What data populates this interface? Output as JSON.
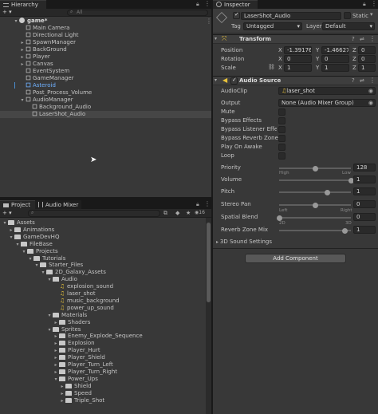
{
  "hierarchy": {
    "tab_label": "Hierarchy",
    "add_label": "+ ▾",
    "search_placeholder": "All",
    "scene_name": "game*",
    "items": [
      {
        "label": "Main Camera",
        "depth": 1,
        "arrow": ""
      },
      {
        "label": "Directional Light",
        "depth": 1,
        "arrow": ""
      },
      {
        "label": "SpawnManager",
        "depth": 1,
        "arrow": "▸"
      },
      {
        "label": "BackGround",
        "depth": 1,
        "arrow": "▸"
      },
      {
        "label": "Player",
        "depth": 1,
        "arrow": "▸"
      },
      {
        "label": "Canvas",
        "depth": 1,
        "arrow": "▸"
      },
      {
        "label": "EventSystem",
        "depth": 1,
        "arrow": ""
      },
      {
        "label": "GameManager",
        "depth": 1,
        "arrow": ""
      },
      {
        "label": "Asteroid",
        "depth": 1,
        "arrow": "",
        "color": "#6fb1ff"
      },
      {
        "label": "Post_Process_Volume",
        "depth": 1,
        "arrow": ""
      },
      {
        "label": "AudioManager",
        "depth": 1,
        "arrow": "▾"
      },
      {
        "label": "Background_Audio",
        "depth": 2,
        "arrow": ""
      },
      {
        "label": "LaserShot_Audio",
        "depth": 2,
        "arrow": "",
        "selected": true
      }
    ]
  },
  "project": {
    "tab_project": "Project",
    "tab_mixer": "Audio Mixer",
    "add_label": "+ ▾",
    "hidden_count": "16",
    "items": [
      {
        "label": "Assets",
        "depth": 0,
        "arrow": "▾",
        "icon": "folder"
      },
      {
        "label": "Animations",
        "depth": 1,
        "arrow": "▸",
        "icon": "folder"
      },
      {
        "label": "GameDevHQ",
        "depth": 1,
        "arrow": "▾",
        "icon": "folder"
      },
      {
        "label": "FileBase",
        "depth": 2,
        "arrow": "▾",
        "icon": "folder"
      },
      {
        "label": "Projects",
        "depth": 3,
        "arrow": "▾",
        "icon": "folder"
      },
      {
        "label": "Tutorials",
        "depth": 4,
        "arrow": "▾",
        "icon": "folder"
      },
      {
        "label": "Starter_Files",
        "depth": 5,
        "arrow": "▾",
        "icon": "folder"
      },
      {
        "label": "2D_Galaxy_Assets",
        "depth": 6,
        "arrow": "▾",
        "icon": "folder"
      },
      {
        "label": "Audio",
        "depth": 7,
        "arrow": "▾",
        "icon": "folder"
      },
      {
        "label": "explosion_sound",
        "depth": 8,
        "arrow": "",
        "icon": "audio"
      },
      {
        "label": "laser_shot",
        "depth": 8,
        "arrow": "",
        "icon": "audio"
      },
      {
        "label": "music_background",
        "depth": 8,
        "arrow": "",
        "icon": "audio"
      },
      {
        "label": "power_up_sound",
        "depth": 8,
        "arrow": "",
        "icon": "audio"
      },
      {
        "label": "Materials",
        "depth": 7,
        "arrow": "▾",
        "icon": "folder"
      },
      {
        "label": "Shaders",
        "depth": 8,
        "arrow": "▸",
        "icon": "folder"
      },
      {
        "label": "Sprites",
        "depth": 7,
        "arrow": "▾",
        "icon": "folder"
      },
      {
        "label": "Enemy_Explode_Sequence",
        "depth": 8,
        "arrow": "▸",
        "icon": "folder"
      },
      {
        "label": "Explosion",
        "depth": 8,
        "arrow": "▸",
        "icon": "folder"
      },
      {
        "label": "Player_Hurt",
        "depth": 8,
        "arrow": "▸",
        "icon": "folder"
      },
      {
        "label": "Player_Shield",
        "depth": 8,
        "arrow": "▸",
        "icon": "folder"
      },
      {
        "label": "Player_Turn_Left",
        "depth": 8,
        "arrow": "▸",
        "icon": "folder"
      },
      {
        "label": "Player_Turn_Right",
        "depth": 8,
        "arrow": "▸",
        "icon": "folder"
      },
      {
        "label": "Power_Ups",
        "depth": 8,
        "arrow": "▾",
        "icon": "folder"
      },
      {
        "label": "Shield",
        "depth": 9,
        "arrow": "▸",
        "icon": "folder"
      },
      {
        "label": "Speed",
        "depth": 9,
        "arrow": "▸",
        "icon": "folder"
      },
      {
        "label": "Triple_Shot",
        "depth": 9,
        "arrow": "▸",
        "icon": "folder"
      }
    ]
  },
  "inspector": {
    "tab_label": "Inspector",
    "object_name": "LaserShot_Audio",
    "static_label": "Static",
    "tag_label": "Tag",
    "tag_value": "Untagged",
    "layer_label": "Layer",
    "layer_value": "Default",
    "transform": {
      "title": "Transform",
      "position_label": "Position",
      "rotation_label": "Rotation",
      "scale_label": "Scale",
      "position": {
        "x": "-1.39176",
        "y": "-1.46627",
        "z": "0"
      },
      "rotation": {
        "x": "0",
        "y": "0",
        "z": "0"
      },
      "scale": {
        "x": "1",
        "y": "1",
        "z": "1"
      }
    },
    "audio_source": {
      "title": "Audio Source",
      "audioclip_label": "AudioClip",
      "audioclip_value": "laser_shot",
      "output_label": "Output",
      "output_value": "None (Audio Mixer Group)",
      "mute_label": "Mute",
      "bypass_effects_label": "Bypass Effects",
      "bypass_listener_label": "Bypass Listener Effects",
      "bypass_reverb_label": "Bypass Reverb Zones",
      "play_on_awake_label": "Play On Awake",
      "loop_label": "Loop",
      "priority_label": "Priority",
      "priority_value": "128",
      "priority_fraction": 0.5,
      "priority_high": "High",
      "priority_low": "Low",
      "volume_label": "Volume",
      "volume_value": "1",
      "volume_fraction": 1.0,
      "pitch_label": "Pitch",
      "pitch_value": "1",
      "pitch_fraction": 0.67,
      "stereo_label": "Stereo Pan",
      "stereo_value": "0",
      "stereo_fraction": 0.5,
      "stereo_left": "Left",
      "stereo_right": "Right",
      "spatial_label": "Spatial Blend",
      "spatial_value": "0",
      "spatial_fraction": 0.0,
      "spatial_2d": "2D",
      "spatial_3d": "3D",
      "reverb_label": "Reverb Zone Mix",
      "reverb_value": "1",
      "reverb_fraction": 0.91,
      "sound3d_label": "3D Sound Settings"
    },
    "add_component_label": "Add Component"
  },
  "colors": {
    "accent": "#2c5d87",
    "selection": "#2c5d87",
    "audio_icon": "#e8c23a"
  }
}
